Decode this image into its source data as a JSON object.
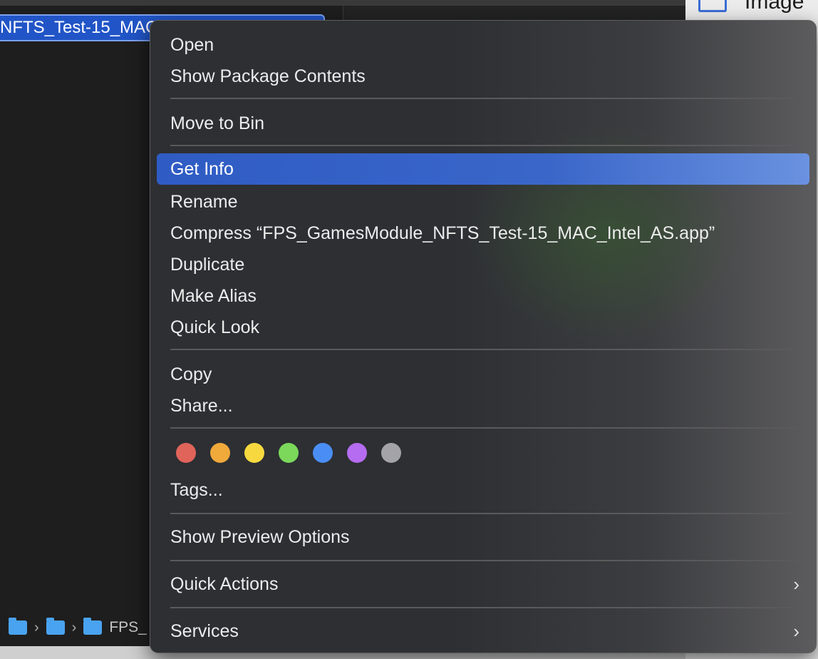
{
  "finder": {
    "selected_file": "NFTS_Test-15_MAC",
    "path_last": "FPS_",
    "preview_label": "Image"
  },
  "menu": {
    "items": {
      "open": "Open",
      "show_package_contents": "Show Package Contents",
      "move_to_bin": "Move to Bin",
      "get_info": "Get Info",
      "rename": "Rename",
      "compress": "Compress “FPS_GamesModule_NFTS_Test-15_MAC_Intel_AS.app”",
      "duplicate": "Duplicate",
      "make_alias": "Make Alias",
      "quick_look": "Quick Look",
      "copy": "Copy",
      "share": "Share...",
      "tags": "Tags...",
      "show_preview_options": "Show Preview Options",
      "quick_actions": "Quick Actions",
      "services": "Services"
    },
    "highlighted_item": "Get Info",
    "submenu_arrow": "›",
    "tag_colors": {
      "red": "#e0645a",
      "orange": "#f0a93b",
      "yellow": "#f7d93f",
      "green": "#7bd85a",
      "blue": "#4a8ef5",
      "purple": "#b56cf0",
      "gray": "#a4a4a8"
    }
  },
  "path_chevron": "›"
}
